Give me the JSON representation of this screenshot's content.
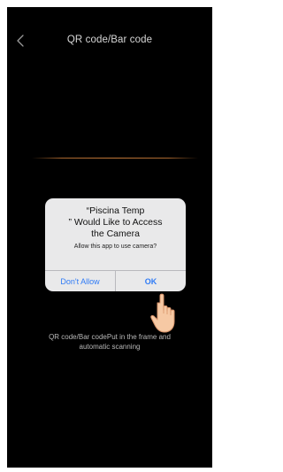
{
  "header": {
    "title": "QR code/Bar code",
    "back_icon": "chevron-left-icon"
  },
  "dialog": {
    "title_line1": "“Piscina Temp",
    "title_line2": "” Would Like to Access",
    "title_line3": "the Camera",
    "message": "Allow this app to use camera?",
    "deny_label": "Don't Allow",
    "ok_label": "OK",
    "button_color": "#2f7bf6"
  },
  "hint": {
    "line1": "QR code/Bar codePut in the frame and",
    "line2": "automatic scanning"
  },
  "colors": {
    "background": "#000000",
    "scan_line": "#c07637",
    "dialog_bg": "#e9e9ea"
  },
  "overlay": {
    "pointer_icon": "pointing-hand-icon"
  }
}
